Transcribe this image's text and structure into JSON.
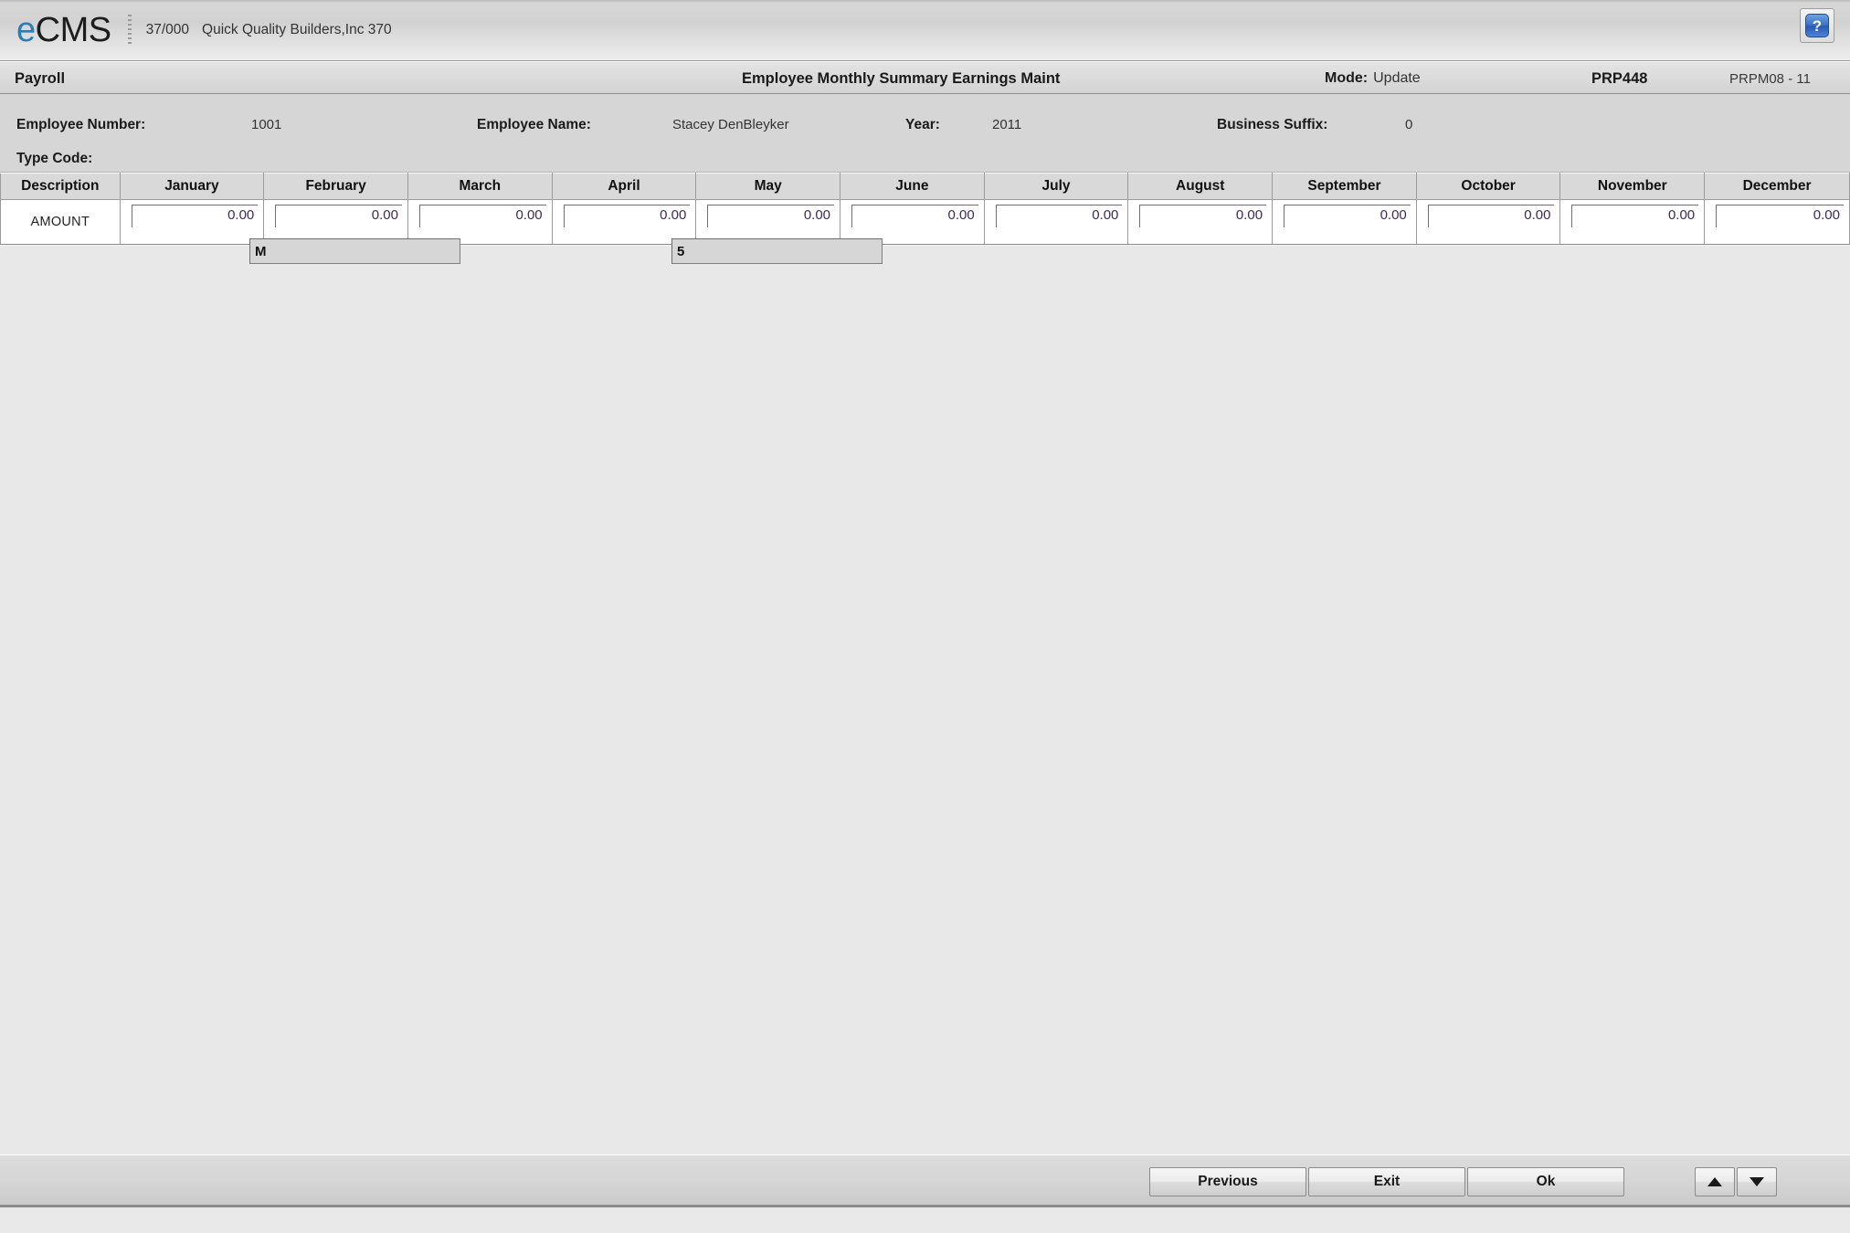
{
  "branding": {
    "logo_e": "e",
    "logo_cms": "CMS",
    "company_code": "37/000",
    "company_name": "Quick Quality Builders,Inc 370",
    "help_glyph": "?",
    "accent_color": "#2c7cb8"
  },
  "title_bar": {
    "module": "Payroll",
    "screen_title": "Employee Monthly Summary Earnings Maint",
    "mode_label": "Mode:",
    "mode_value": "Update",
    "program_id": "PRP448",
    "screen_id": "PRPM08 - 11"
  },
  "info": {
    "employee_number_label": "Employee Number:",
    "employee_number_value": "1001",
    "employee_name_label": "Employee Name:",
    "employee_name_value": "Stacey DenBleyker",
    "year_label": "Year:",
    "year_value": "2011",
    "business_suffix_label": "Business Suffix:",
    "business_suffix_value": "0",
    "type_code_label": "Type Code:",
    "type_code_value": "M",
    "type_code_placeholder": "",
    "secondary_code_value": "5",
    "secondary_code_placeholder": ""
  },
  "grid": {
    "columns": [
      "Description",
      "January",
      "February",
      "March",
      "April",
      "May",
      "June",
      "July",
      "August",
      "September",
      "October",
      "November",
      "December"
    ],
    "rows": [
      {
        "description": "AMOUNT",
        "values": [
          "0.00",
          "0.00",
          "0.00",
          "0.00",
          "0.00",
          "0.00",
          "0.00",
          "0.00",
          "0.00",
          "0.00",
          "0.00",
          "0.00"
        ]
      }
    ]
  },
  "buttons": {
    "previous": "Previous",
    "exit": "Exit",
    "ok": "Ok",
    "scroll_up": "▲",
    "scroll_down": "▼"
  }
}
